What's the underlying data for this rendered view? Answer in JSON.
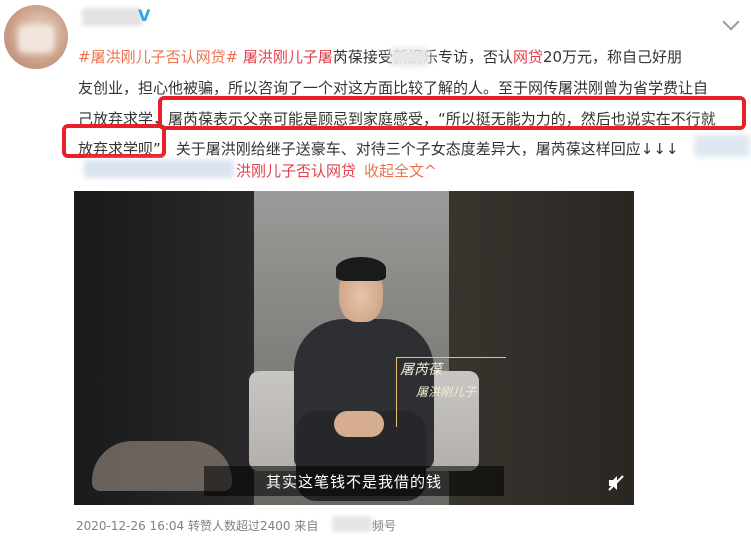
{
  "post": {
    "line1": [
      {
        "text": "#屠洪刚儿子否认网贷#",
        "kind": "topic"
      },
      {
        "text": " 屠洪刚儿子屠",
        "kind": "kw"
      },
      {
        "text": "芮葆接受新",
        "kind": "plain"
      },
      {
        "text": "娱乐专访，否认",
        "kind": "plain"
      },
      {
        "text": "网贷",
        "kind": "kw"
      },
      {
        "text": "20万元，称自己好朋",
        "kind": "plain"
      }
    ],
    "line2": "友创业，担心他被骗，所以咨询了一个对这方面比较了解的人。至于网传屠洪刚曾为省学费让自",
    "line3": "己放弃求学，屠芮葆表示父亲可能是顾忌到家庭感受，“所以挺无能为力的，然后也说实在不行就",
    "line4": "放弃求学呗”，关于屠洪刚给继子送豪车、对待三个子女态度差异大，屠芮葆这样回应↓↓↓",
    "line5_link": "洪刚儿子否认网贷",
    "collapse_label": "收起全文^"
  },
  "video": {
    "caption_name": "屠芮葆",
    "caption_sub": "屠洪刚儿子",
    "subtitle": "其实这笔钱不是我借的钱"
  },
  "meta": {
    "timestamp": "2020-12-26 16:04",
    "reposts": "转赞人数超过2400",
    "from_label": "来自",
    "source_suffix": "频号"
  },
  "icons": {
    "verified": "verified-icon",
    "chevron": "chevron-down-icon",
    "mute": "mute-icon"
  },
  "colors": {
    "topic": "#eb7350",
    "keyword": "#e2414a",
    "highlight_box": "#e8202a",
    "meta_text": "#808080"
  }
}
